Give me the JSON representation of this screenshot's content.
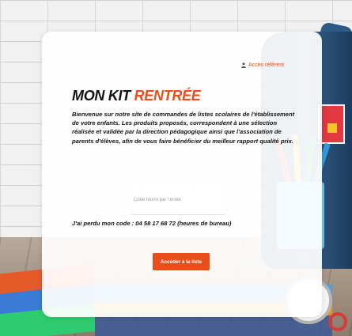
{
  "header": {
    "referent_link": "Accès référent"
  },
  "hero": {
    "title_part1": "MON KIT ",
    "title_part2": "RENTRÉE",
    "intro": "Bienvenue sur notre site de commandes de listes scolaires de l'établissement de votre enfants. Les produits proposés, correspondent à une sélection réalisée et validée par la direction pédagogique ainsi que l'association de parents d'élèves, afin de vous faire bénéficier du meilleur rapport qualité prix."
  },
  "form": {
    "code_value": "",
    "code_placeholder": "Code fourni par l'école",
    "lost_code": "J'ai perdu mon code : 04 58 17 68 72 (heures de bureau)",
    "submit_label": "Accéder à la liste"
  },
  "colors": {
    "accent": "#e84e1b",
    "text": "#111111",
    "card": "#ffffff"
  },
  "icons": {
    "referent": "user-icon"
  }
}
